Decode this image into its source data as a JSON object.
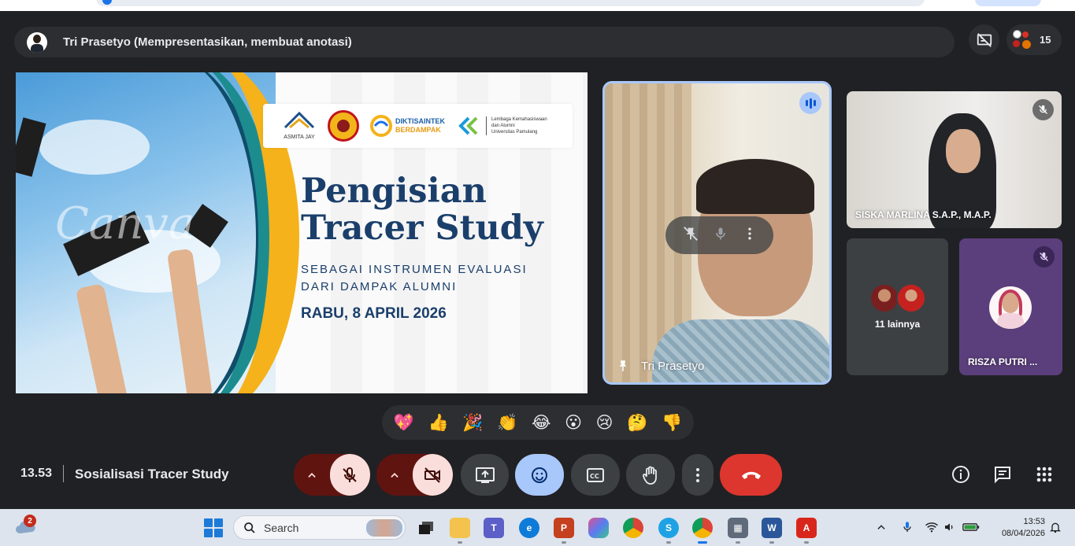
{
  "presenter_bar": {
    "title": "Tri Prasetyo (Mempresentasikan, membuat anotasi)"
  },
  "people": {
    "count": "15"
  },
  "slide": {
    "title_line1": "Pengisian",
    "title_line2": "Tracer Study",
    "subtitle_line1": "SEBAGAI INSTRUMEN EVALUASI",
    "subtitle_line2": "DARI DAMPAK ALUMNI",
    "date": "RABU, 8 APRIL 2026",
    "watermark": "Canva",
    "logos": {
      "logo1_text": "ASMITA JAY",
      "logo3_line1": "DIKTISAINTEK",
      "logo3_line2": "BERDAMPAK",
      "logo4_line1": "Lembaga Kemahasiswaan",
      "logo4_line2": "dan Alumni",
      "logo4_line3": "Universitas Pamulang"
    }
  },
  "participants": {
    "main_speaker": "Tri Prasetyo",
    "tile2": "SISKA MARLINA S.A.P., M.A.P.",
    "others_label": "11 lainnya",
    "tile4": "RISZA PUTRI ..."
  },
  "reactions": [
    "💖",
    "👍",
    "🎉",
    "👏",
    "😂",
    "😮",
    "😢",
    "🤔",
    "👎"
  ],
  "meeting": {
    "time": "13.53",
    "name": "Sosialisasi Tracer Study"
  },
  "taskbar": {
    "notification_count": "2",
    "search_label": "Search",
    "clock_time": "13:53",
    "clock_date": "08/04/2026"
  },
  "colors": {
    "meet_bg": "#202124",
    "active_speaker_border": "#a8c7fa",
    "muted_control_bg": "#f9dedc",
    "hangup_red": "#dc362e",
    "slide_title_blue": "#1b3f6b"
  }
}
